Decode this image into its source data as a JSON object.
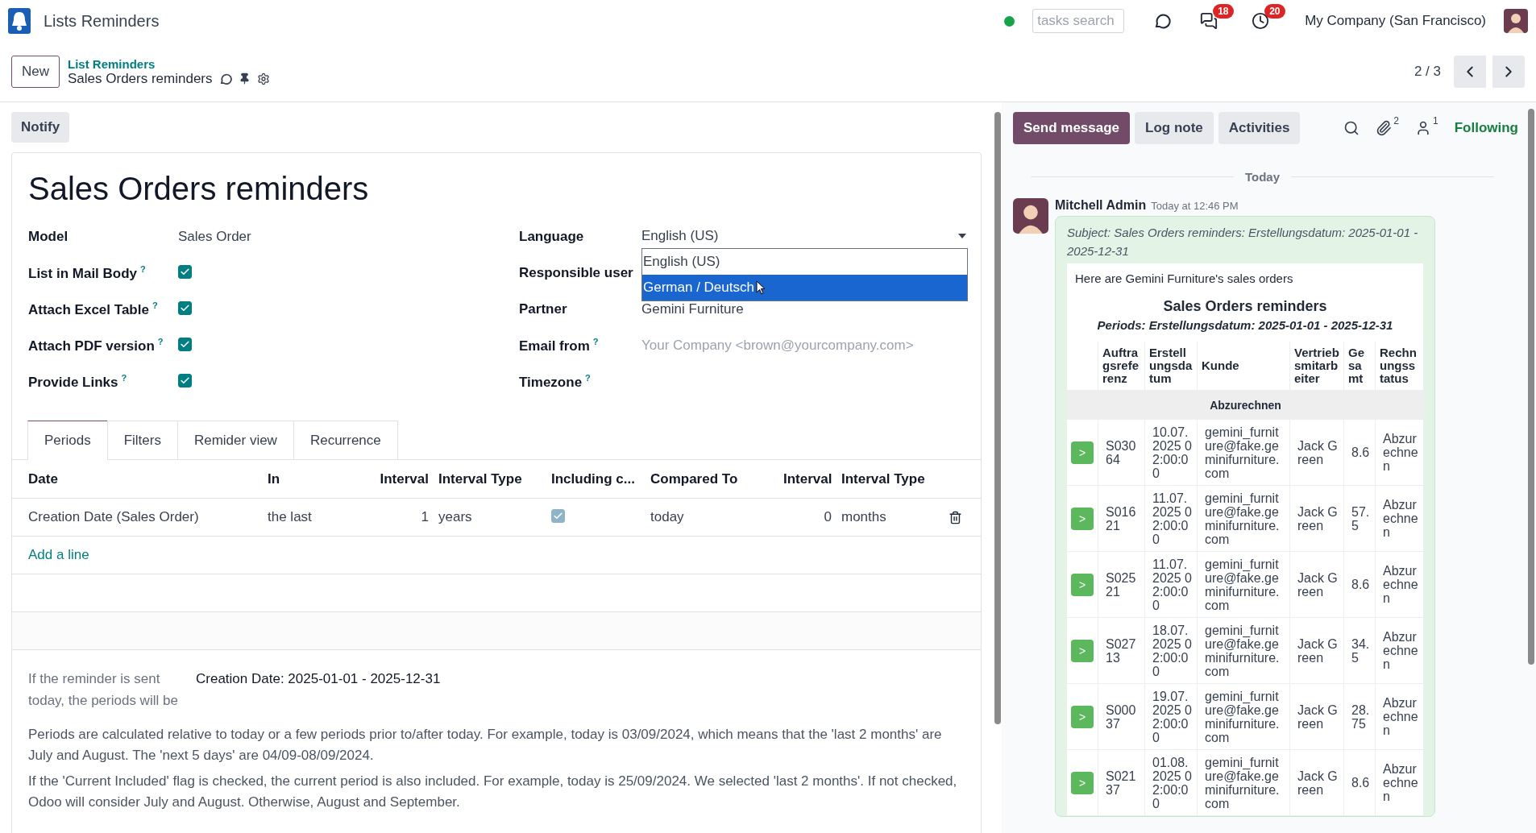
{
  "app": {
    "name": "Lists Reminders",
    "online": true,
    "search_placeholder": "tasks search",
    "messages_count": "18",
    "activities_count": "20",
    "company": "My Company (San Francisco)"
  },
  "control_panel": {
    "new_button": "New",
    "parent": "List Reminders",
    "current": "Sales Orders reminders",
    "pager": "2 / 3"
  },
  "form": {
    "notify": "Notify",
    "title": "Sales Orders reminders",
    "left_fields": [
      {
        "kind": "text",
        "label": "Model",
        "value": "Sales Order"
      },
      {
        "kind": "checkbox",
        "label": "List in Mail Body",
        "help": "?",
        "checked": true
      },
      {
        "kind": "checkbox",
        "label": "Attach Excel Table",
        "help": "?",
        "checked": true
      },
      {
        "kind": "checkbox",
        "label": "Attach PDF version",
        "help": "?",
        "checked": true
      },
      {
        "kind": "checkbox",
        "label": "Provide Links",
        "help": "?",
        "checked": true
      }
    ],
    "right_fields": [
      {
        "kind": "select",
        "label": "Language",
        "value": "English (US)",
        "options": [
          {
            "label": "English (US)",
            "highlighted": false
          },
          {
            "label": "German / Deutsch",
            "highlighted": true
          }
        ]
      },
      {
        "kind": "text",
        "label": "Responsible user"
      },
      {
        "kind": "text",
        "label": "Partner",
        "value": "Gemini Furniture"
      },
      {
        "kind": "placeholder",
        "label": "Email from",
        "help": "?",
        "placeholder": "Your Company <brown@yourcompany.com>"
      },
      {
        "kind": "text",
        "label": "Timezone",
        "help": "?"
      }
    ],
    "tabs": [
      {
        "label": "Periods",
        "selected": true
      },
      {
        "label": "Filters",
        "selected": false
      },
      {
        "label": "Remider view",
        "selected": false
      },
      {
        "label": "Recurrence",
        "selected": false
      }
    ],
    "periods": {
      "columns": [
        "Date",
        "In",
        "Interval",
        "Interval Type",
        "Including c...",
        "Compared To",
        "Interval",
        "Interval Type"
      ],
      "rows": [
        {
          "date": "Creation Date (Sales Order)",
          "in": "the last",
          "interval": "1",
          "interval_type": "years",
          "including_current": true,
          "compared_to": "today",
          "interval_2": "0",
          "interval_type_2": "months"
        }
      ],
      "add_line": "Add a line"
    },
    "preview_label": "If the reminder is sent today, the periods will be",
    "preview_value": "Creation Date: 2025-01-01 - 2025-12-31",
    "notes": [
      "Periods are calculated relative to today or a few periods prior to/after today. For example, today is 03/09/2024, which means that the 'last 2 months' are July and August. The 'next 5 days' are 04/09-08/09/2024.",
      "If the 'Current Included' flag is checked, the current period is also included. For example, today is 25/09/2024. We selected 'last 2 months'. If not checked, Odoo will consider July and August. Otherwise, August and September."
    ]
  },
  "chatter": {
    "buttons": [
      {
        "label": "Send message",
        "kind": "primary"
      },
      {
        "label": "Log note",
        "kind": "secondary"
      },
      {
        "label": "Activities",
        "kind": "secondary"
      }
    ],
    "attachments_count": "2",
    "followers_count": "1",
    "follow": "Following",
    "separator": "Today",
    "message": {
      "author": "Mitchell Admin",
      "time": "Today at 12:46 PM",
      "subject": "Subject: Sales Orders reminders: Erstellungsdatum: 2025-01-01 - 2025-12-31",
      "intro": "Here are Gemini Furniture's sales orders",
      "title": "Sales Orders reminders",
      "periods": "Periods: Erstellungsdatum: 2025-01-01 - 2025-12-31",
      "columns": [
        "Auftragsreferenz",
        "Erstellungsdatum",
        "Kunde",
        "Vertriebsmitarbeiter",
        "Gesamt",
        "Rechnungsstatus"
      ],
      "group": "Abzurechnen",
      "rows": [
        {
          "action": ">",
          "ref": "S03064",
          "date": "10.07.2025 02:00:00",
          "customer": "gemini_furniture@fake.geminifurniture.com",
          "salesperson": "Jack Green",
          "total": "8.6",
          "status": "Abzurechnen"
        },
        {
          "action": ">",
          "ref": "S01621",
          "date": "11.07.2025 02:00:00",
          "customer": "gemini_furniture@fake.geminifurniture.com",
          "salesperson": "Jack Green",
          "total": "57.5",
          "status": "Abzurechnen"
        },
        {
          "action": ">",
          "ref": "S02521",
          "date": "11.07.2025 02:00:00",
          "customer": "gemini_furniture@fake.geminifurniture.com",
          "salesperson": "Jack Green",
          "total": "8.6",
          "status": "Abzurechnen"
        },
        {
          "action": ">",
          "ref": "S02713",
          "date": "18.07.2025 02:00:00",
          "customer": "gemini_furniture@fake.geminifurniture.com",
          "salesperson": "Jack Green",
          "total": "34.5",
          "status": "Abzurechnen"
        },
        {
          "action": ">",
          "ref": "S00037",
          "date": "19.07.2025 02:00:00",
          "customer": "gemini_furniture@fake.geminifurniture.com",
          "salesperson": "Jack Green",
          "total": "28.75",
          "status": "Abzurechnen"
        },
        {
          "action": ">",
          "ref": "S02137",
          "date": "01.08.2025 02:00:00",
          "customer": "gemini_furniture@fake.geminifurniture.com",
          "salesperson": "Jack Green",
          "total": "8.6",
          "status": "Abzurechnen"
        }
      ]
    }
  }
}
